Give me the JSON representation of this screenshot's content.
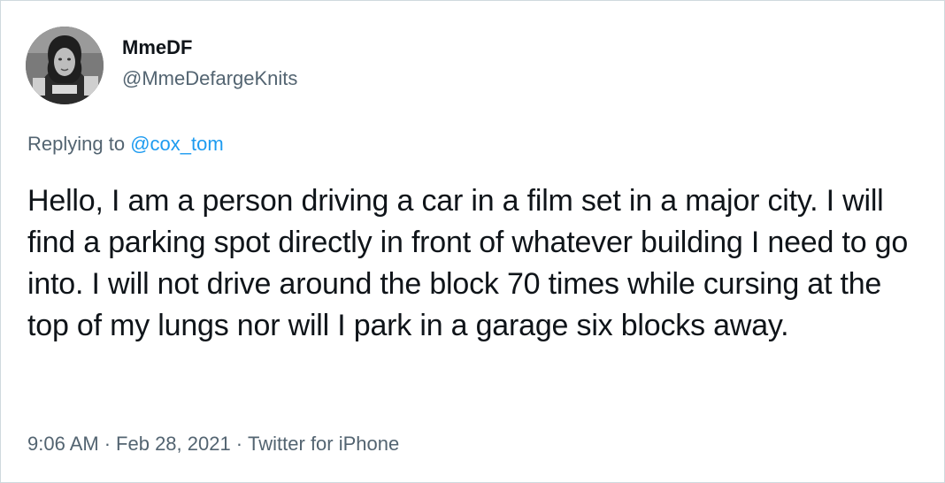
{
  "user": {
    "display_name": "MmeDF",
    "handle": "@MmeDefargeKnits"
  },
  "reply": {
    "prefix": "Replying to ",
    "mention": "@cox_tom"
  },
  "tweet": {
    "text": "Hello, I am a person driving a car in a film set in a major city. I will find a parking spot directly in front of whatever building I need to go into. I will not drive around the block 70 times while cursing at the top of my lungs nor will I park in a garage six blocks away."
  },
  "meta": {
    "time": "9:06 AM",
    "separator": "·",
    "date": "Feb 28, 2021",
    "source": "Twitter for iPhone"
  },
  "colors": {
    "text_primary": "#0f1419",
    "text_secondary": "#536471",
    "link": "#1d9bf0",
    "border": "#cfd9de"
  }
}
